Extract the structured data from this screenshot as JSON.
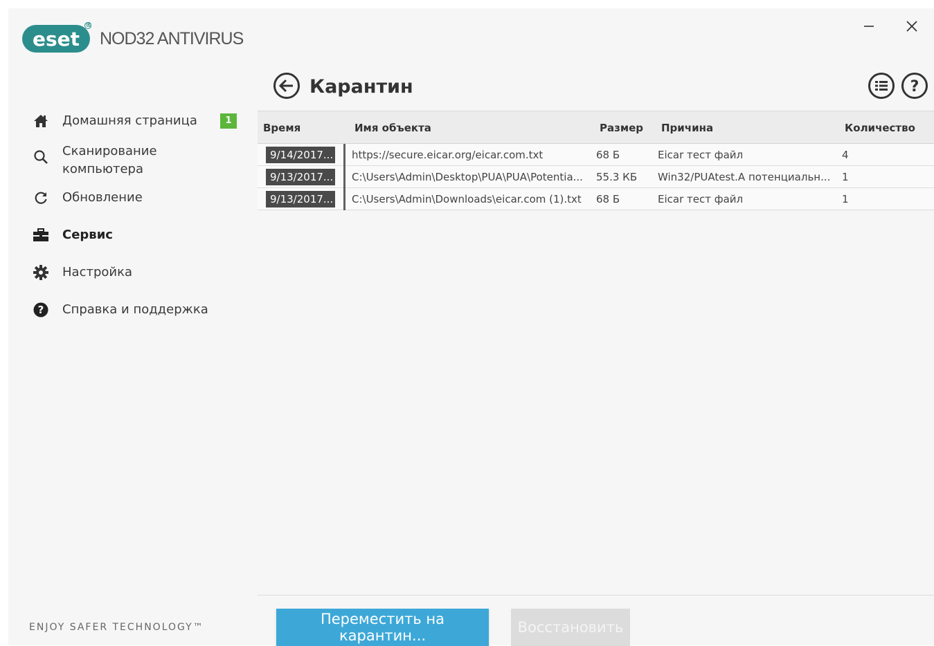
{
  "app": {
    "brand_logo": "eset",
    "product_name": "NOD32 ANTIVIRUS",
    "tagline": "ENJOY SAFER TECHNOLOGY™",
    "accent_color": "#2c8e8c"
  },
  "window_controls": {
    "minimize_icon": "minimize-icon",
    "close_icon": "close-icon"
  },
  "sidebar": {
    "items": [
      {
        "label": "Домашняя страница",
        "icon": "home-icon",
        "badge": "1"
      },
      {
        "label": "Сканирование компьютера",
        "icon": "search-icon"
      },
      {
        "label": "Обновление",
        "icon": "refresh-icon"
      },
      {
        "label": "Сервис",
        "icon": "toolbox-icon",
        "active": true
      },
      {
        "label": "Настройка",
        "icon": "gear-icon"
      },
      {
        "label": "Справка и поддержка",
        "icon": "question-icon"
      }
    ],
    "badge_color": "#5cb63b"
  },
  "page": {
    "title": "Карантин",
    "back_icon": "back-arrow-icon",
    "list_icon": "list-menu-icon",
    "help_icon": "help-icon"
  },
  "table": {
    "columns": [
      "Время",
      "Имя объекта",
      "Размер",
      "Причина",
      "Количество"
    ],
    "rows": [
      {
        "time": "9/14/2017...",
        "name": "https://secure.eicar.org/eicar.com.txt",
        "size": "68 Б",
        "reason": "Eicar тест файл",
        "count": "4"
      },
      {
        "time": "9/13/2017...",
        "name": "C:\\Users\\Admin\\Desktop\\PUA\\PUA\\Potentia...",
        "size": "55.3 КБ",
        "reason": "Win32/PUAtest.A потенциальн...",
        "count": "1"
      },
      {
        "time": "9/13/2017...",
        "name": "C:\\Users\\Admin\\Downloads\\eicar.com (1).txt",
        "size": "68 Б",
        "reason": "Eicar тест файл",
        "count": "1"
      }
    ]
  },
  "actions": {
    "quarantine_label": "Переместить на карантин...",
    "restore_label": "Восстановить",
    "primary_color": "#3da8d8"
  }
}
